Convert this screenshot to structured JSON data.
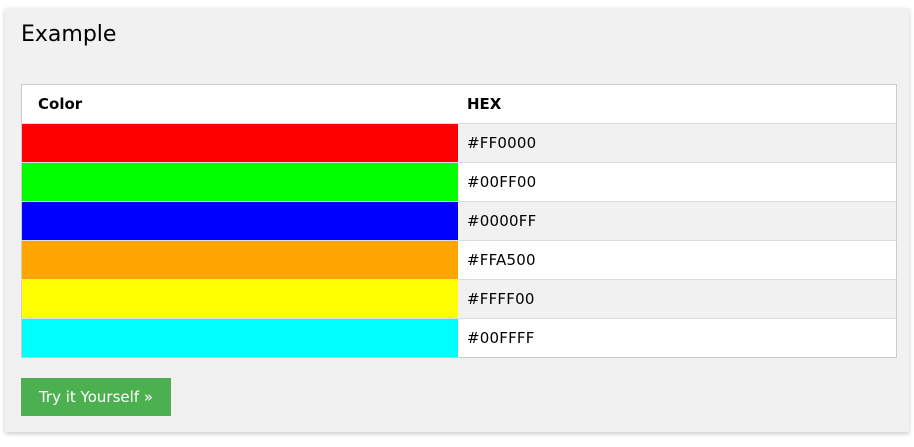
{
  "example": {
    "title": "Example",
    "table": {
      "headers": [
        "Color",
        "HEX"
      ],
      "rows": [
        {
          "swatch_color": "#FF0000",
          "hex": "#FF0000"
        },
        {
          "swatch_color": "#00FF00",
          "hex": "#00FF00"
        },
        {
          "swatch_color": "#0000FF",
          "hex": "#0000FF"
        },
        {
          "swatch_color": "#FFA500",
          "hex": "#FFA500"
        },
        {
          "swatch_color": "#FFFF00",
          "hex": "#FFFF00"
        },
        {
          "swatch_color": "#00FFFF",
          "hex": "#00FFFF"
        }
      ]
    },
    "button": {
      "label": "Try it Yourself »",
      "color": "#4CAF50"
    }
  }
}
